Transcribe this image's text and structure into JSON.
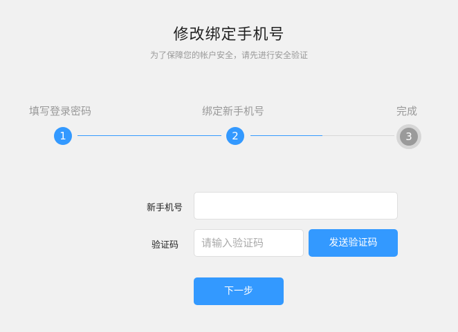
{
  "header": {
    "title": "修改绑定手机号",
    "subtitle": "为了保障您的帐户安全，请先进行安全验证"
  },
  "steps": [
    {
      "label": "填写登录密码",
      "number": "1",
      "state": "done"
    },
    {
      "label": "绑定新手机号",
      "number": "2",
      "state": "active"
    },
    {
      "label": "完成",
      "number": "3",
      "state": "pending"
    }
  ],
  "colors": {
    "accent": "#3399ff",
    "inactive": "#9a9a9a",
    "background": "#f1f1f1"
  },
  "form": {
    "phone_label": "新手机号",
    "phone_value": "",
    "phone_placeholder": "",
    "code_label": "验证码",
    "code_value": "",
    "code_placeholder": "请输入验证码",
    "send_code_label": "发送验证码",
    "next_label": "下一步"
  }
}
